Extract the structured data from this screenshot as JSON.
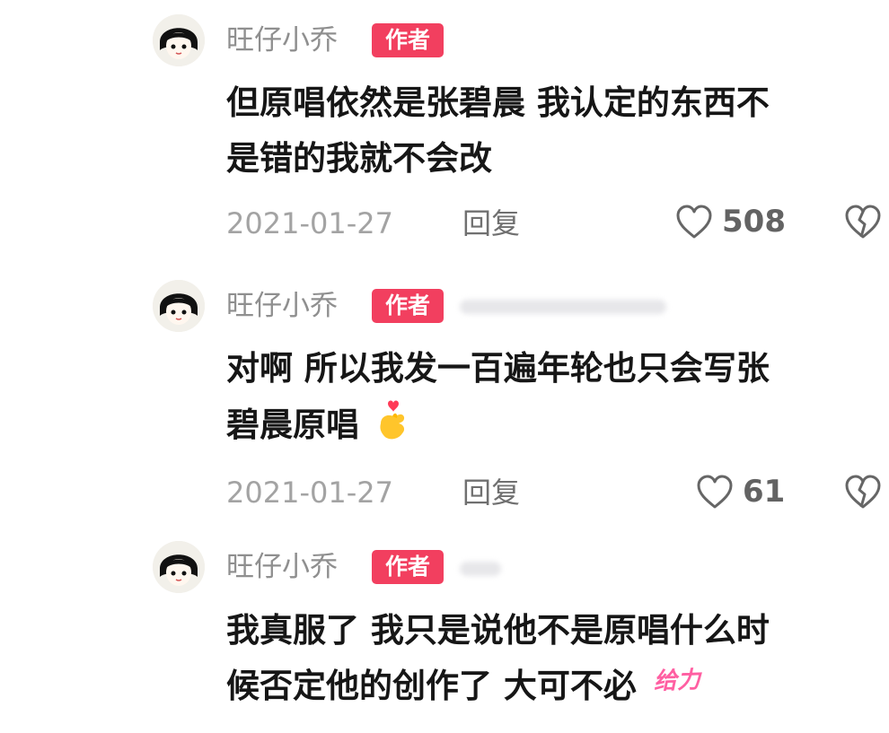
{
  "comments": [
    {
      "username": "旺仔小乔",
      "badge": "作者",
      "text_lines": [
        "但原唱依然是张碧晨 我认定的东西不",
        "是错的我就不会改"
      ],
      "date": "2021-01-27",
      "reply_label": "回复",
      "likes": "508",
      "emoji": "",
      "sticker": ""
    },
    {
      "username": "旺仔小乔",
      "badge": "作者",
      "text_lines": [
        "对啊 所以我发一百遍年轮也只会写张",
        "碧晨原唱"
      ],
      "date": "2021-01-27",
      "reply_label": "回复",
      "likes": "61",
      "emoji": "finger-heart-emoji",
      "sticker": ""
    },
    {
      "username": "旺仔小乔",
      "badge": "作者",
      "text_lines": [
        "我真服了 我只是说他不是原唱什么时",
        "候否定他的创作了 大可不必"
      ],
      "date": "",
      "reply_label": "",
      "likes": "",
      "emoji": "",
      "sticker": "给力"
    }
  ],
  "icons": {
    "like": "heart-outline-icon",
    "dislike": "broken-heart-outline-icon"
  },
  "colors": {
    "badge": "#f23f5f",
    "username": "#8f8f8f",
    "text": "#161616",
    "meta": "#a3a3a3",
    "sticker": "#ff5fa2"
  }
}
